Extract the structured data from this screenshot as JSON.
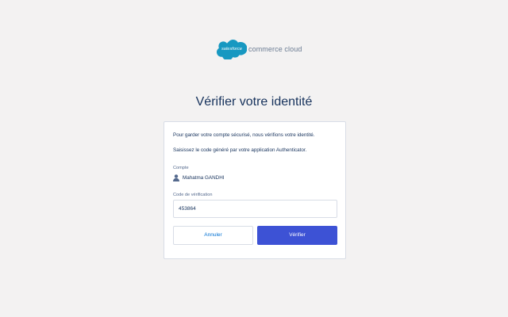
{
  "brand": {
    "logo_text": "salesforce",
    "product": "commerce cloud",
    "cloud_color": "#1798c1"
  },
  "page": {
    "title": "Vérifier votre identité"
  },
  "card": {
    "intro_line1": "Pour garder votre compte sécurisé, nous vérifions votre identité.",
    "intro_line2": "Saisissez le code généré par votre application Authenticator.",
    "account_label": "Compte",
    "account_icon": "user-icon",
    "account_name": "Mahatma GANDHI",
    "code_label": "Code de vérification",
    "code_value": "453864",
    "cancel_label": "Annuler",
    "verify_label": "Vérifier"
  },
  "colors": {
    "background": "#f3f2f2",
    "primary": "#3d52d5",
    "link": "#0070d2",
    "text": "#16325c"
  }
}
